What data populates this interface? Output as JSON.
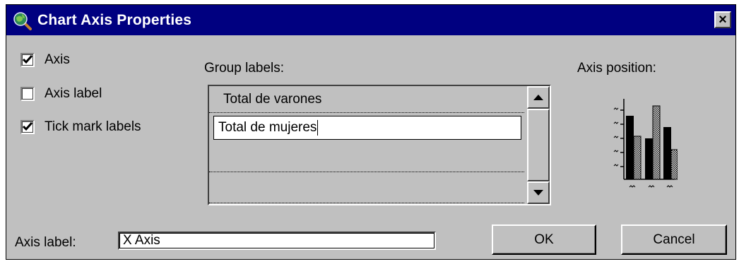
{
  "window": {
    "title": "Chart Axis Properties",
    "close_glyph": "×"
  },
  "options": [
    {
      "label": "Axis",
      "checked": true
    },
    {
      "label": "Axis label",
      "checked": false
    },
    {
      "label": "Tick mark labels",
      "checked": true
    }
  ],
  "group_labels": {
    "title": "Group labels:",
    "rows": [
      "Total de varones",
      "Total de mujeres",
      "",
      ""
    ],
    "editing_index": 1
  },
  "axis_position": {
    "title": "Axis position:",
    "icon": "axis-position-preview-icon"
  },
  "axis_label": {
    "label": "Axis label:",
    "value": "X Axis"
  },
  "buttons": {
    "ok": "OK",
    "cancel": "Cancel"
  },
  "colors": {
    "titlebar": "#000080",
    "face": "#c0c0c0"
  }
}
